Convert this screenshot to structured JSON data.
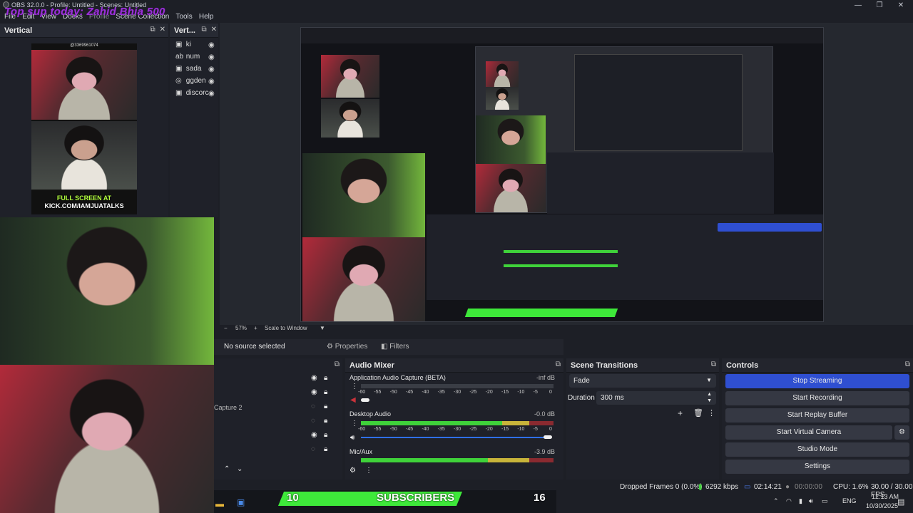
{
  "window": {
    "title": "OBS 32.0.0 - Profile: Untitled - Scenes: Untitled",
    "overlay_text": "Top sup today: Zahid Bhia 500",
    "minimize": "—",
    "restore": "❐",
    "close": "✕"
  },
  "menu": [
    "File",
    "Edit",
    "View",
    "Docks",
    "Profile",
    "Scene Collection",
    "Tools",
    "Help"
  ],
  "vertical_dock": {
    "title": "Vertical",
    "handle": "@3369961074",
    "banner_line1": "FULL SCREEN AT",
    "banner_line2": "KICK.COM/IAMJUATALKS"
  },
  "vert_sources": {
    "title": "Vert...",
    "items": [
      {
        "label": "ki",
        "icon": "image-icon"
      },
      {
        "label": "num",
        "icon": "text-icon"
      },
      {
        "label": "sada",
        "icon": "image-icon"
      },
      {
        "label": "ggden",
        "icon": "browser-icon"
      },
      {
        "label": "discorc",
        "icon": "image-icon"
      }
    ]
  },
  "preview_toolbar": {
    "zoom_minus": "−",
    "zoom": "57%",
    "zoom_plus": "+",
    "scale_label": "Scale to Window"
  },
  "source_toolbar": {
    "status": "No source selected",
    "properties": "Properties",
    "filters": "Filters"
  },
  "sources_partial": {
    "capture_label": "Capture 2"
  },
  "audio_mixer": {
    "title": "Audio Mixer",
    "channels": [
      {
        "name": "Application Audio Capture (BETA)",
        "level": "-inf dB",
        "fill": 0.0
      },
      {
        "name": "Desktop Audio",
        "level": "-0.0 dB",
        "fill": 0.87
      },
      {
        "name": "Mic/Aux",
        "level": "-3.9 dB",
        "fill": 0.82
      }
    ],
    "scale_ticks": [
      "-60",
      "-55",
      "-50",
      "-45",
      "-40",
      "-35",
      "-30",
      "-25",
      "-20",
      "-15",
      "-10",
      "-5",
      "0"
    ]
  },
  "scene_transitions": {
    "title": "Scene Transitions",
    "transition": "Fade",
    "duration_label": "Duration",
    "duration_value": "300 ms"
  },
  "controls": {
    "title": "Controls",
    "buttons": [
      "Stop Streaming",
      "Start Recording",
      "Start Replay Buffer",
      "Start Virtual Camera",
      "Studio Mode",
      "Settings"
    ]
  },
  "status_bar": {
    "dropped_frames": "Dropped Frames 0 (0.0%)",
    "bitrate": "6292 kbps",
    "stream_time": "02:14:21",
    "rec_time": "00:00:00",
    "cpu": "CPU: 1.6%",
    "fps": "30.00 / 30.00 FPS"
  },
  "subscriber_bar": {
    "left_number": "10",
    "label": "SUBSCRIBERS",
    "right_number": "16"
  },
  "tray": {
    "lang": "ENG",
    "time": "12:13 AM",
    "date": "10/30/2025"
  },
  "colors": {
    "accent_blue": "#2f4fd1",
    "meter_green": "#3fd23a",
    "meter_yellow": "#c8b43a",
    "meter_red": "#c8323a",
    "overlay_purple": "#9b30d9",
    "sub_green": "#3ee83a"
  }
}
